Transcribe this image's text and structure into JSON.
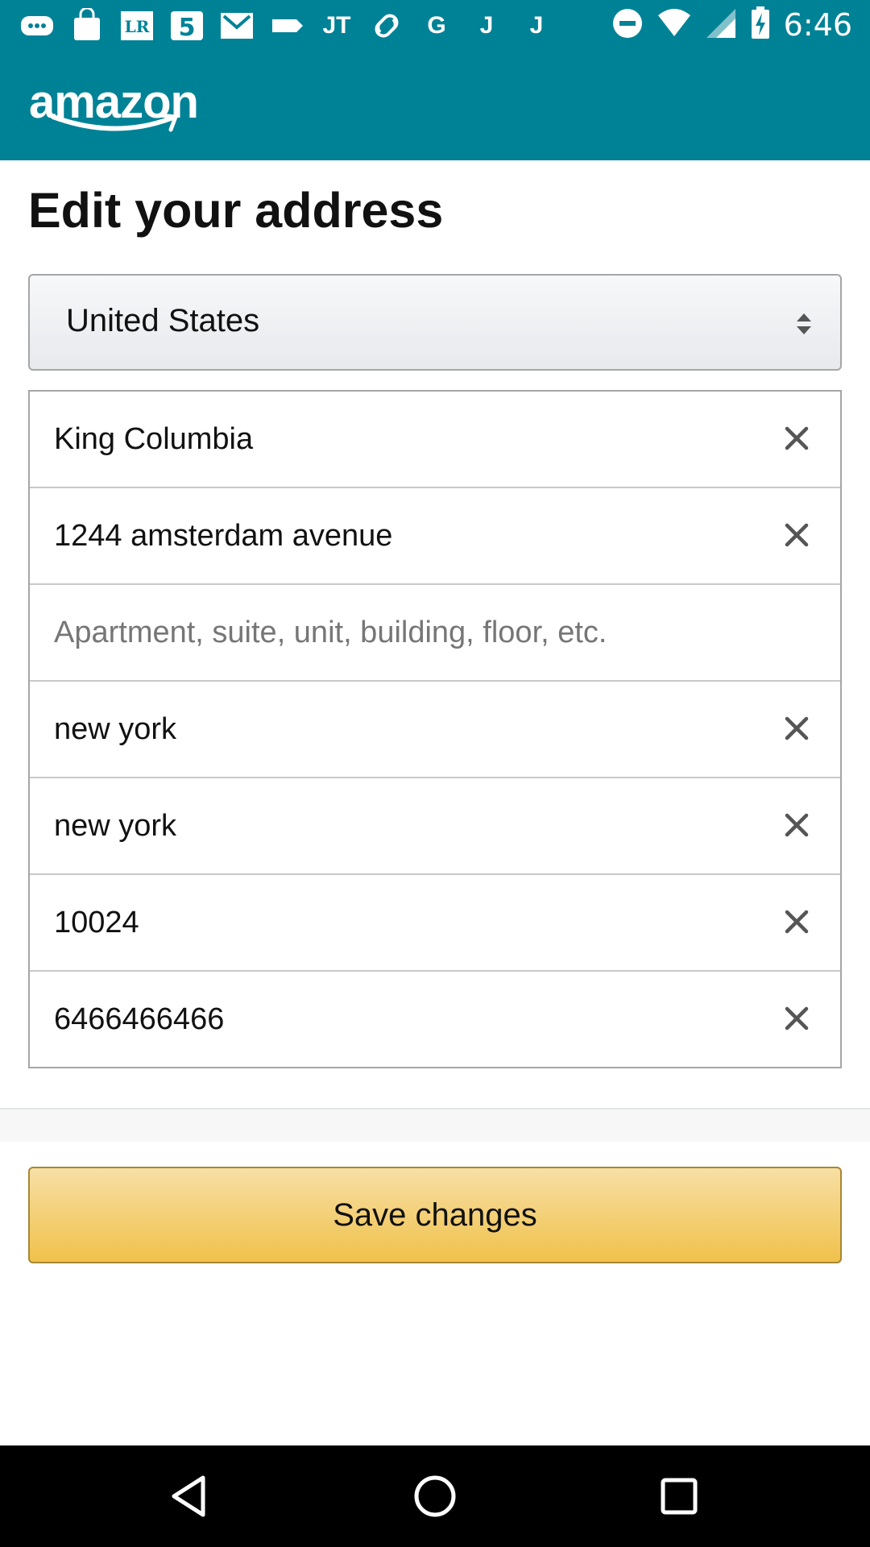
{
  "status_bar": {
    "time": "6:46",
    "notification_icons": [
      "chat-bubble-icon",
      "shopping-bag-icon",
      "lr-icon",
      "five-icon",
      "gmail-icon",
      "tag-icon",
      "jt-icon",
      "link-icon",
      "google-icon",
      "j-icon",
      "j-icon"
    ],
    "lr_text": "LR",
    "five_text": "5",
    "jt_text": "JT",
    "g_text": "G",
    "j_text": "J"
  },
  "app_bar": {
    "logo_text": "amazon",
    "color": "#008296"
  },
  "page": {
    "title": "Edit your address"
  },
  "country_select": {
    "value": "United States"
  },
  "fields": [
    {
      "value": "King Columbia",
      "placeholder": "",
      "clearable": true
    },
    {
      "value": "1244 amsterdam avenue",
      "placeholder": "",
      "clearable": true
    },
    {
      "value": "",
      "placeholder": "Apartment, suite, unit, building, floor, etc.",
      "clearable": false
    },
    {
      "value": "new york",
      "placeholder": "",
      "clearable": true
    },
    {
      "value": "new york",
      "placeholder": "",
      "clearable": true
    },
    {
      "value": "10024",
      "placeholder": "",
      "clearable": true
    },
    {
      "value": "6466466466",
      "placeholder": "",
      "clearable": true
    }
  ],
  "save_button": {
    "label": "Save changes",
    "color": "#f0c14b"
  },
  "nav_bar": {
    "icons": [
      "back-triangle-icon",
      "home-circle-icon",
      "recents-square-icon"
    ]
  }
}
